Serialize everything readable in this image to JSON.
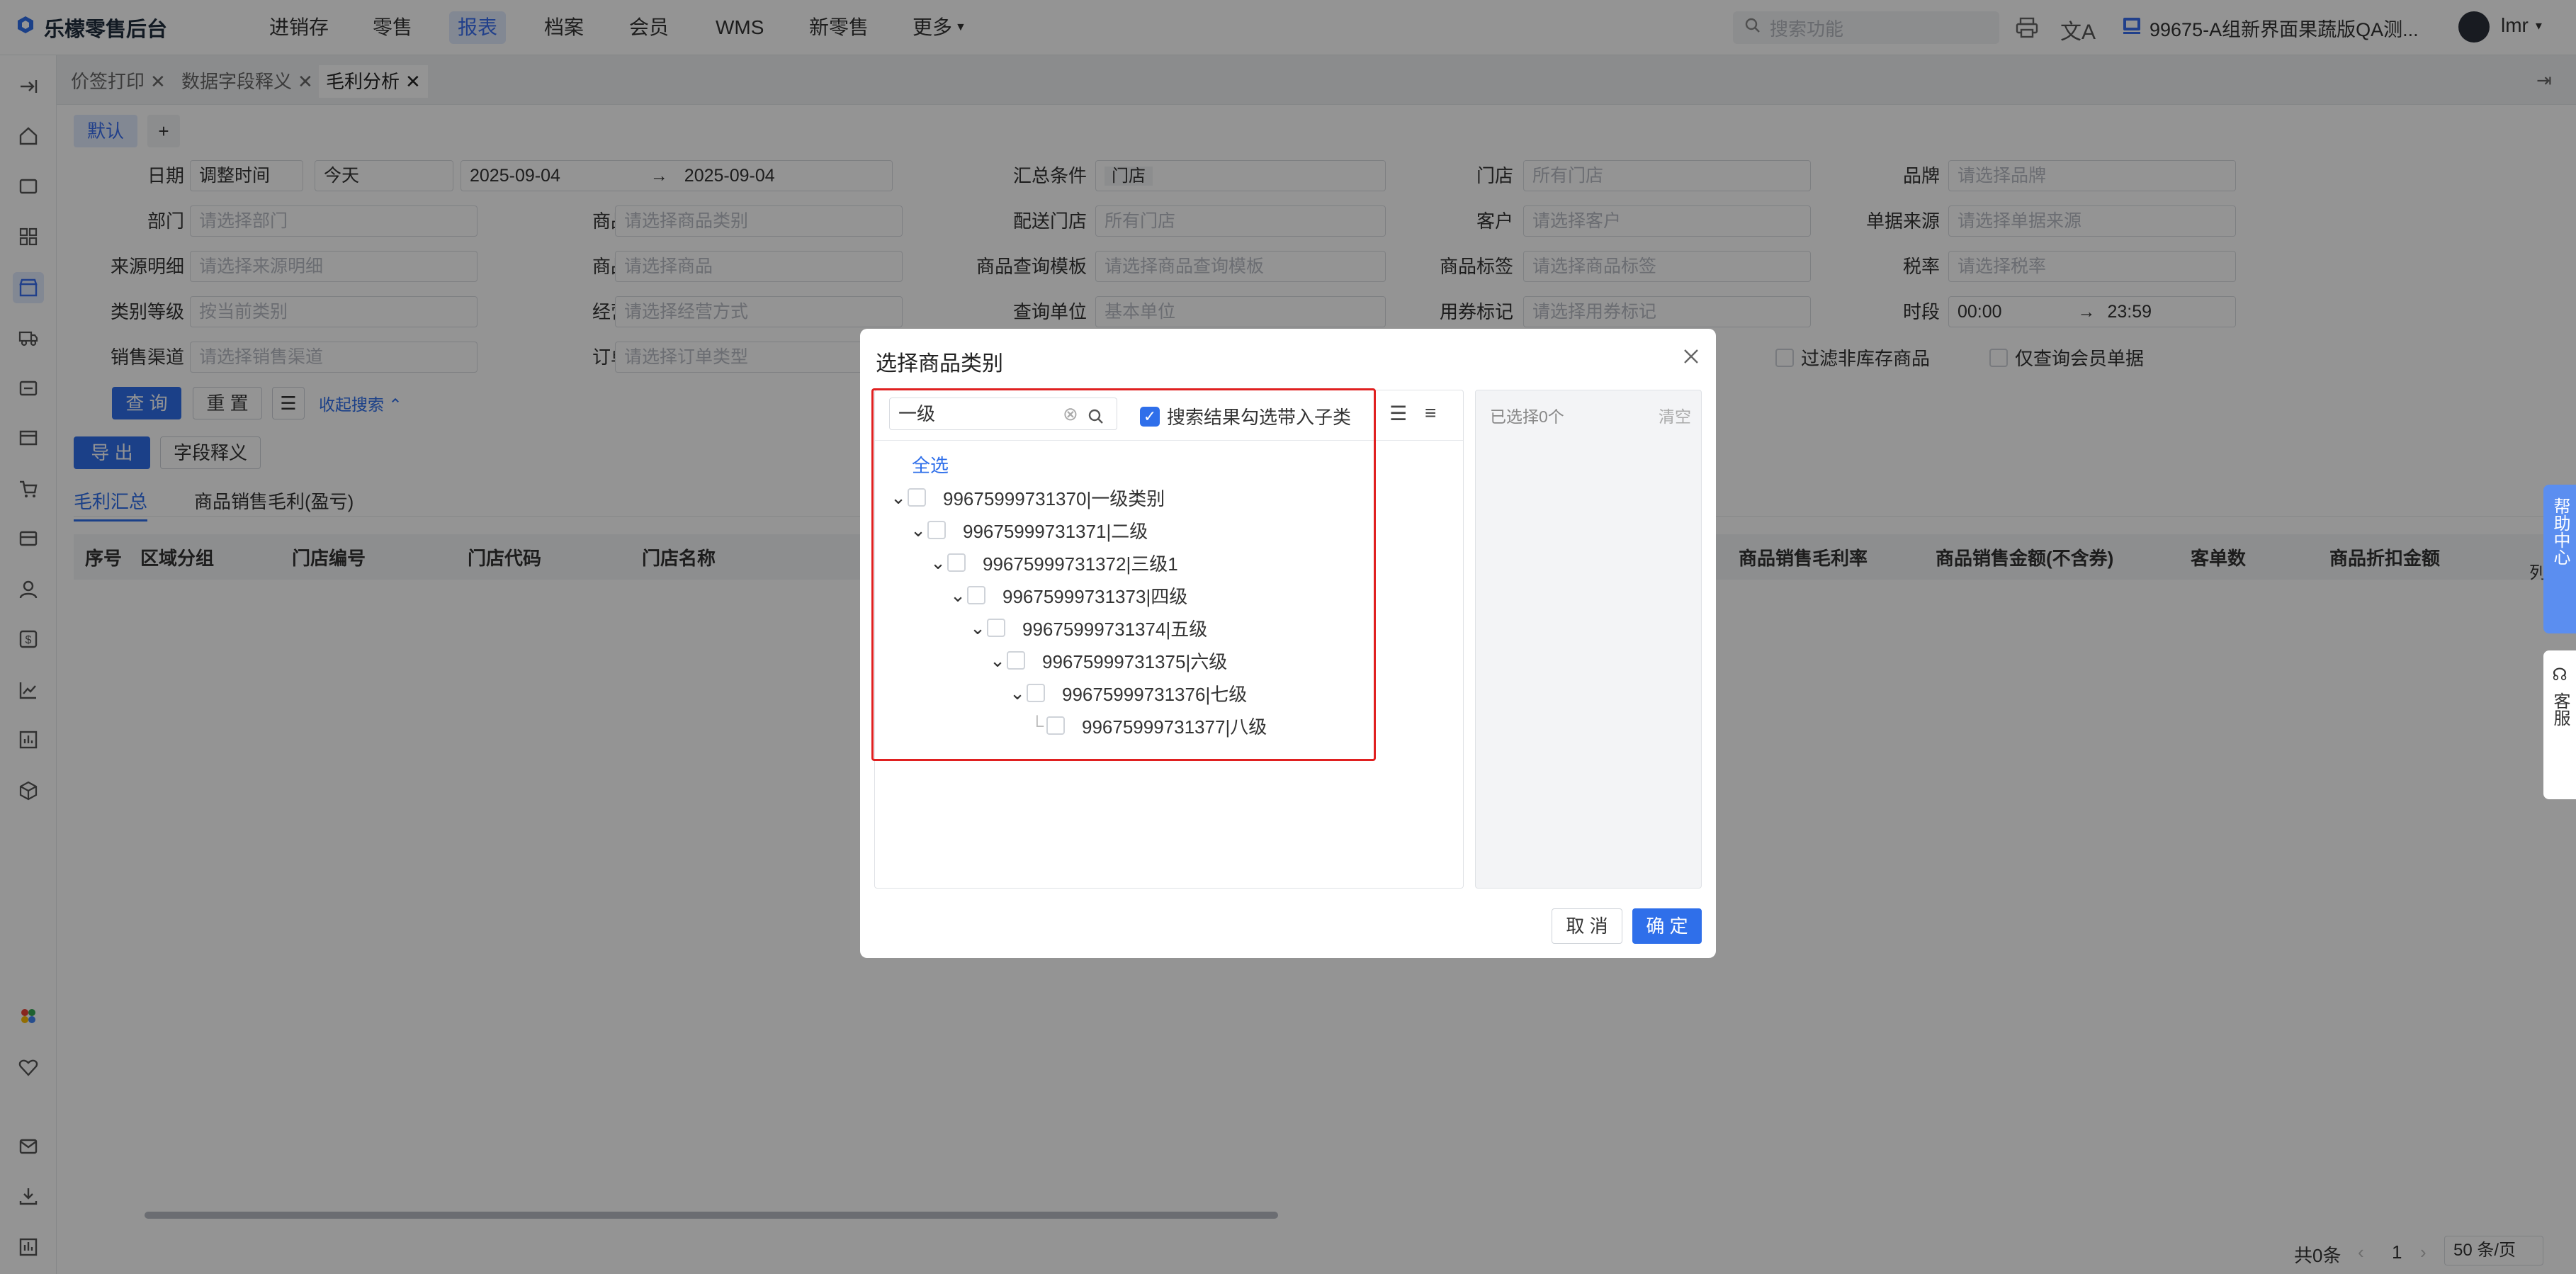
{
  "app": {
    "title": "乐檬零售后台"
  },
  "nav": {
    "items": [
      "进销存",
      "零售",
      "报表",
      "档案",
      "会员",
      "WMS",
      "新零售",
      "更多"
    ],
    "active_index": 2,
    "search_placeholder": "搜索功能",
    "org": "99675-A组新界面果蔬版QA测...",
    "user": "lmr"
  },
  "tabs": [
    {
      "label": "价签打印"
    },
    {
      "label": "数据字段释义"
    },
    {
      "label": "毛利分析"
    }
  ],
  "filters": {
    "preset": "默认",
    "add": "+",
    "date_label": "日期",
    "date_type": "调整时间",
    "date_range": "今天",
    "date_from": "2025-09-04",
    "date_sep": "→",
    "date_to": "2025-09-04",
    "summary_label": "汇总条件",
    "summary_tag": "门店",
    "store_label": "门店",
    "store_ph": "所有门店",
    "brand_label": "品牌",
    "brand_ph": "请选择品牌",
    "dept_label": "部门",
    "dept_ph": "请选择部门",
    "category_label": "商品类别",
    "category_ph": "请选择商品类别",
    "delivery_label": "配送门店",
    "delivery_ph": "所有门店",
    "customer_label": "客户",
    "customer_ph": "请选择客户",
    "source_label": "单据来源",
    "source_ph": "请选择单据来源",
    "src_detail_label": "来源明细",
    "src_detail_ph": "请选择来源明细",
    "archive_label": "商品档案",
    "archive_ph": "请选择商品",
    "template_label": "商品查询模板",
    "template_ph": "请选择商品查询模板",
    "tag_label": "商品标签",
    "tag_ph": "请选择商品标签",
    "tax_label": "税率",
    "tax_ph": "请选择税率",
    "level_label": "类别等级",
    "level_ph": "按当前类别",
    "mode_label": "经营方式",
    "mode_ph": "请选择经营方式",
    "unit_label": "查询单位",
    "unit_val": "基本单位",
    "coupon_label": "用券标记",
    "coupon_ph": "请选择用券标记",
    "period_label": "时段",
    "period_from": "00:00",
    "period_sep": "→",
    "period_to": "23:59",
    "channel_label": "销售渠道",
    "channel_ph": "请选择销售渠道",
    "order_label": "订单类型",
    "order_ph": "请选择订单类型",
    "filter_stock": "过滤非库存商品",
    "member_only": "仅查询会员单据",
    "query_btn": "查 询",
    "reset_btn": "重 置",
    "collapse": "收起搜索"
  },
  "actions": {
    "export": "导 出",
    "fields": "字段释义"
  },
  "subtabs": [
    "毛利汇总",
    "商品销售毛利(盈亏)"
  ],
  "table": {
    "headers_left": [
      "序号",
      "区域分组",
      "门店编号",
      "门店代码",
      "门店名称"
    ],
    "headers_right": [
      "商品销售毛利率",
      "商品销售金额(不含券)",
      "客单数",
      "商品折扣金额"
    ],
    "col_more": "列"
  },
  "pager": {
    "total": "共0条",
    "page": "1",
    "size": "50 条/页"
  },
  "float": {
    "help": "帮助中心",
    "service": "客服"
  },
  "dialog": {
    "title": "选择商品类别",
    "search_value": "一级",
    "include_children": "搜索结果勾选带入子类",
    "select_all": "全选",
    "tree": [
      "99675999731370|一级类别",
      "99675999731371|二级",
      "99675999731372|三级1",
      "99675999731373|四级",
      "99675999731374|五级",
      "99675999731375|六级",
      "99675999731376|七级",
      "99675999731377|八级"
    ],
    "selected": "已选择0个",
    "clear": "清空",
    "cancel": "取 消",
    "ok": "确 定"
  },
  "colors": {
    "primary": "#2f6fea",
    "highlight": "#e02020"
  }
}
